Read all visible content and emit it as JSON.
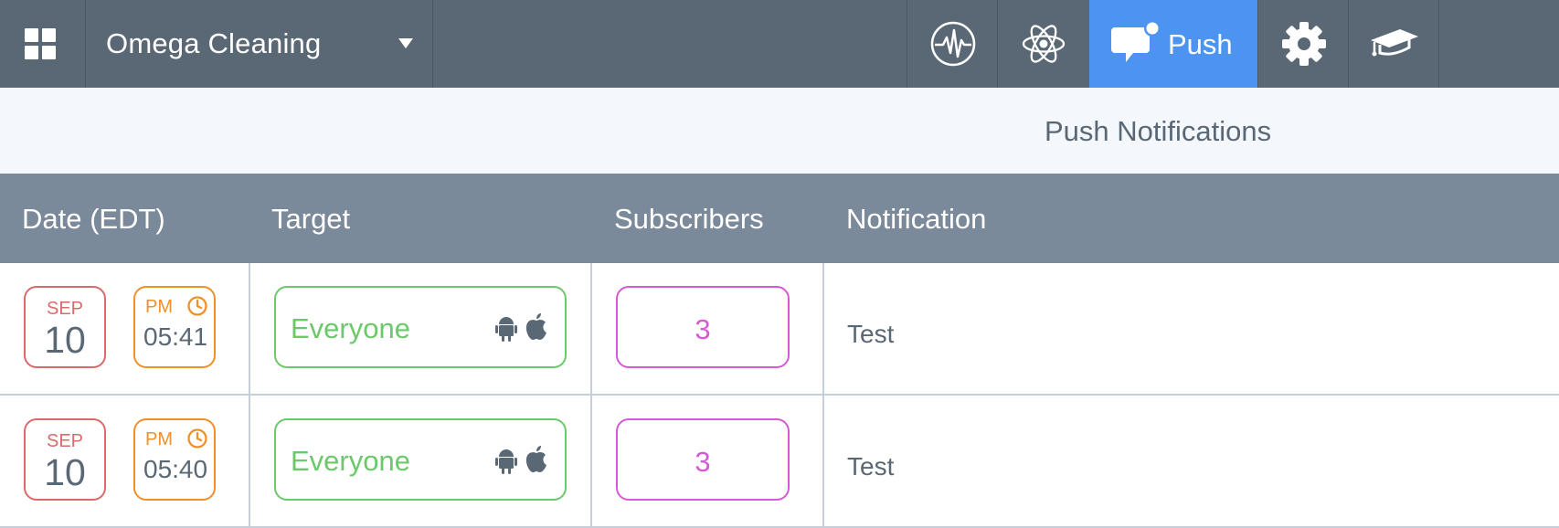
{
  "header": {
    "app_name": "Omega Cleaning",
    "nav": [
      {
        "icon": "pulse-icon"
      },
      {
        "icon": "atom-icon"
      },
      {
        "icon": "push-chat-icon",
        "label": "Push",
        "active": true
      },
      {
        "icon": "gear-icon"
      },
      {
        "icon": "graduation-cap-icon"
      }
    ]
  },
  "subheader": {
    "title": "Push Notifications"
  },
  "table": {
    "columns": [
      "Date (EDT)",
      "Target",
      "Subscribers",
      "Notification"
    ],
    "rows": [
      {
        "month": "SEP",
        "day": "10",
        "ampm": "PM",
        "time": "05:41",
        "target": "Everyone",
        "subscribers": "3",
        "notification": "Test"
      },
      {
        "month": "SEP",
        "day": "10",
        "ampm": "PM",
        "time": "05:40",
        "target": "Everyone",
        "subscribers": "3",
        "notification": "Test"
      }
    ]
  },
  "colors": {
    "navbar": "#5a6875",
    "active_tab": "#4d94f0",
    "table_header": "#7b8a9a",
    "date_red": "#d96b6b",
    "time_orange": "#f0902a",
    "target_green": "#6cc96a",
    "subscribers_magenta": "#d55ad5"
  }
}
